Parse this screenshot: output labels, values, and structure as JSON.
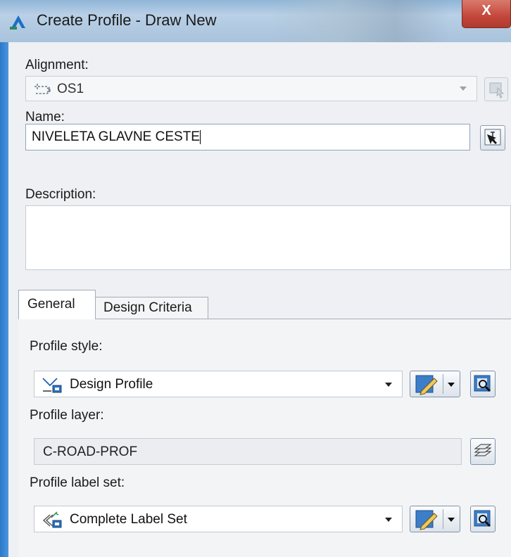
{
  "window": {
    "title": "Create Profile - Draw New",
    "close_label": "X"
  },
  "alignment": {
    "label": "Alignment:",
    "value": "OS1",
    "icon": "alignment-icon"
  },
  "name": {
    "label": "Name:",
    "value": "NIVELETA GLAVNE CESTE"
  },
  "description": {
    "label": "Description:",
    "value": ""
  },
  "tabs": [
    {
      "label": "General",
      "active": true
    },
    {
      "label": "Design Criteria",
      "active": false
    }
  ],
  "general": {
    "profile_style": {
      "label": "Profile style:",
      "value": "Design Profile",
      "icon": "profile-style-icon"
    },
    "profile_layer": {
      "label": "Profile layer:",
      "value": "C-ROAD-PROF"
    },
    "profile_label_set": {
      "label": "Profile label set:",
      "value": "Complete Label Set",
      "icon": "label-set-icon"
    }
  },
  "colors": {
    "window_frame": "#1e6ec8",
    "dialog_bg": "#eef0f3",
    "close_button": "#c2473a"
  }
}
